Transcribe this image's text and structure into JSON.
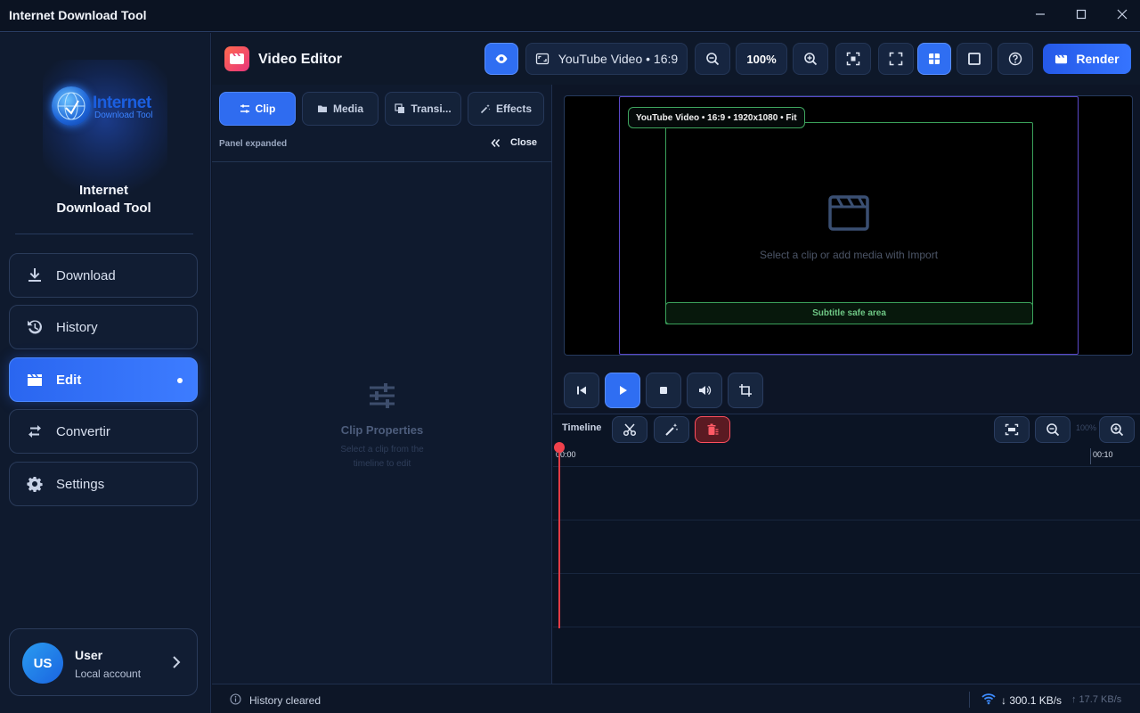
{
  "window": {
    "title": "Internet Download Tool",
    "controls": [
      "minimize-icon",
      "maximize-icon",
      "close-icon"
    ]
  },
  "sidebar": {
    "logo": {
      "line1": "Internet",
      "line2": "Download Tool"
    },
    "brand_name": [
      "Internet",
      "Download Tool"
    ],
    "items": [
      {
        "label": "Download",
        "icon": "download-icon",
        "active": false
      },
      {
        "label": "History",
        "icon": "history-icon",
        "active": false
      },
      {
        "label": "Edit",
        "icon": "clapperboard-icon",
        "active": true
      },
      {
        "label": "Convertir",
        "icon": "swap-arrows-icon",
        "active": false
      },
      {
        "label": "Settings",
        "icon": "gear-icon",
        "active": false
      }
    ],
    "user": {
      "initials": "US",
      "name": "User",
      "subtitle": "Local account"
    }
  },
  "header": {
    "title": "Video Editor",
    "preview_toggle_icon": "eye-icon",
    "format_label": "YouTube Video • 16:9",
    "zoom_level": "100%",
    "render_label": "Render"
  },
  "panel": {
    "tabs": [
      {
        "label": "Clip",
        "icon": "sliders-icon",
        "active": true
      },
      {
        "label": "Media",
        "icon": "folder-icon",
        "active": false
      },
      {
        "label": "Transi...",
        "icon": "layers-icon",
        "active": false
      },
      {
        "label": "Effects",
        "icon": "magic-wand-icon",
        "active": false
      }
    ],
    "status": "Panel expanded",
    "close_label": "Close",
    "empty_title": "Clip Properties",
    "empty_subtitle": "Select a clip from the timeline to edit"
  },
  "preview": {
    "canvas_label": "YouTube Video • 16:9 • 1920x1080 • Fit",
    "empty_message": "Select a clip or add media with Import",
    "subtitle_safe_label": "Subtitle safe area"
  },
  "timeline": {
    "label": "Timeline",
    "zoom_percent": "100%",
    "start_time": "00:00",
    "end_time": "00:10"
  },
  "statusbar": {
    "message": "History cleared",
    "download_speed": "↓ 300.1 KB/s",
    "upload_speed": "↑ 17.7 KB/s"
  },
  "colors": {
    "accent": "#2f6ef2",
    "background": "#0d1526",
    "danger": "#ff4f5e",
    "safe_area": "#3aa05a",
    "canvas_border": "#5a48c9",
    "playhead": "#e23b45"
  }
}
